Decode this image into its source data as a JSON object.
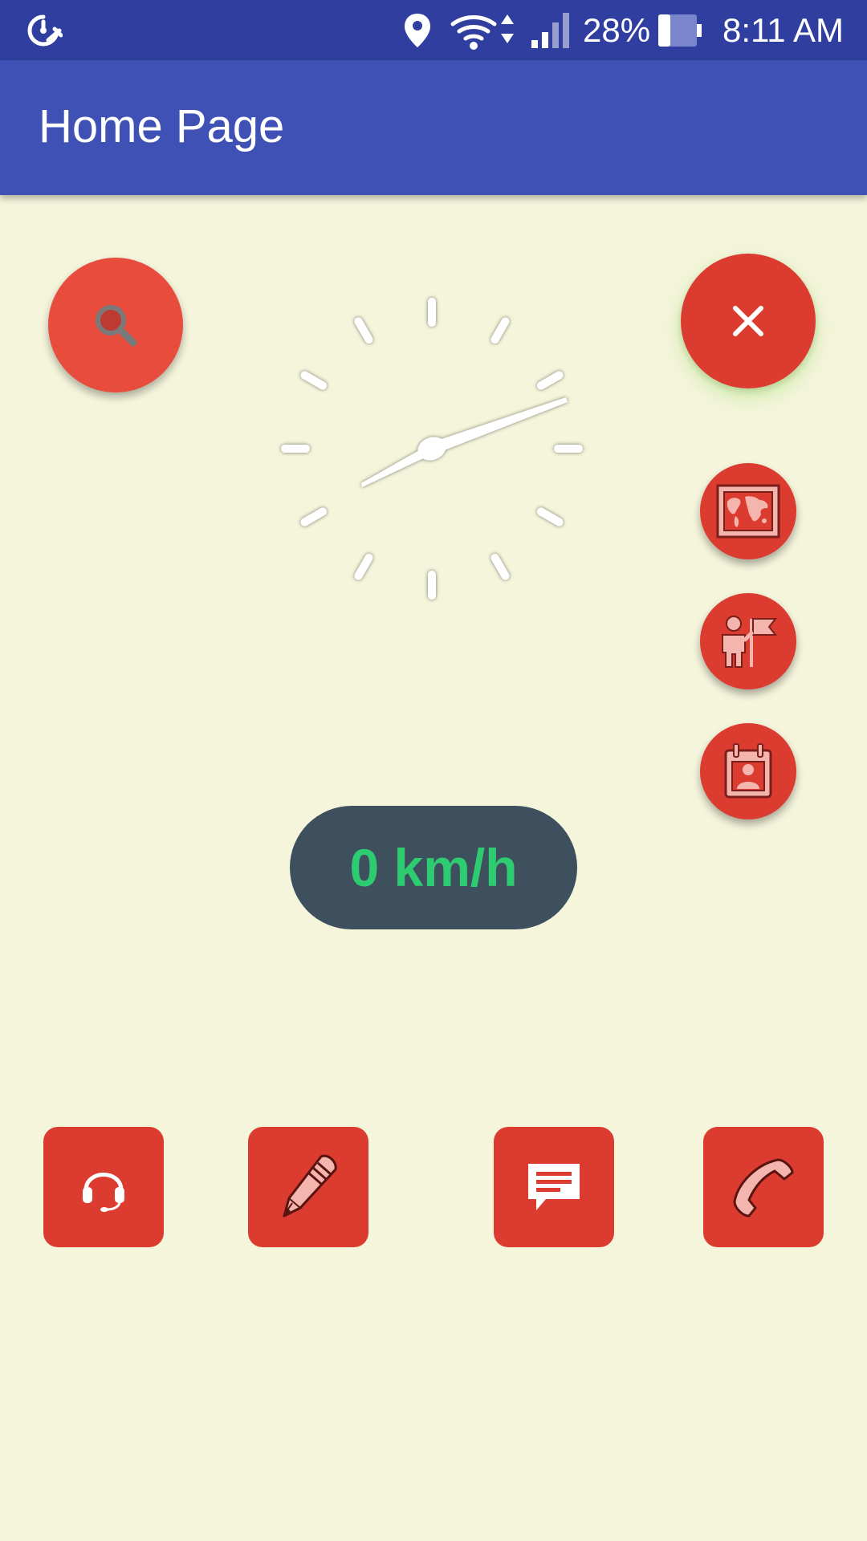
{
  "status_bar": {
    "battery_percent": "28%",
    "time": "8:11 AM",
    "icons": [
      "speedometer-icon",
      "location-icon",
      "wifi-icon",
      "signal-icon",
      "battery-icon"
    ]
  },
  "app_bar": {
    "title": "Home Page"
  },
  "speed": {
    "label": "0 km/h"
  },
  "fabs": {
    "search_icon": "search-icon",
    "close_icon": "close-icon",
    "mini": [
      "world-map-icon",
      "guide-flag-icon",
      "calendar-contact-icon"
    ]
  },
  "bottom_buttons": [
    "headset-icon",
    "pencil-icon",
    "message-icon",
    "phone-icon"
  ],
  "colors": {
    "status_bar": "#303f9f",
    "app_bar": "#3f51b5",
    "background": "#f5f5dc",
    "accent_red": "#dc3b30",
    "search_red": "#e84c3d",
    "speed_pill": "#3e4f5e",
    "speed_text": "#2ecc71",
    "icon_pink": "#f4b5ae"
  }
}
